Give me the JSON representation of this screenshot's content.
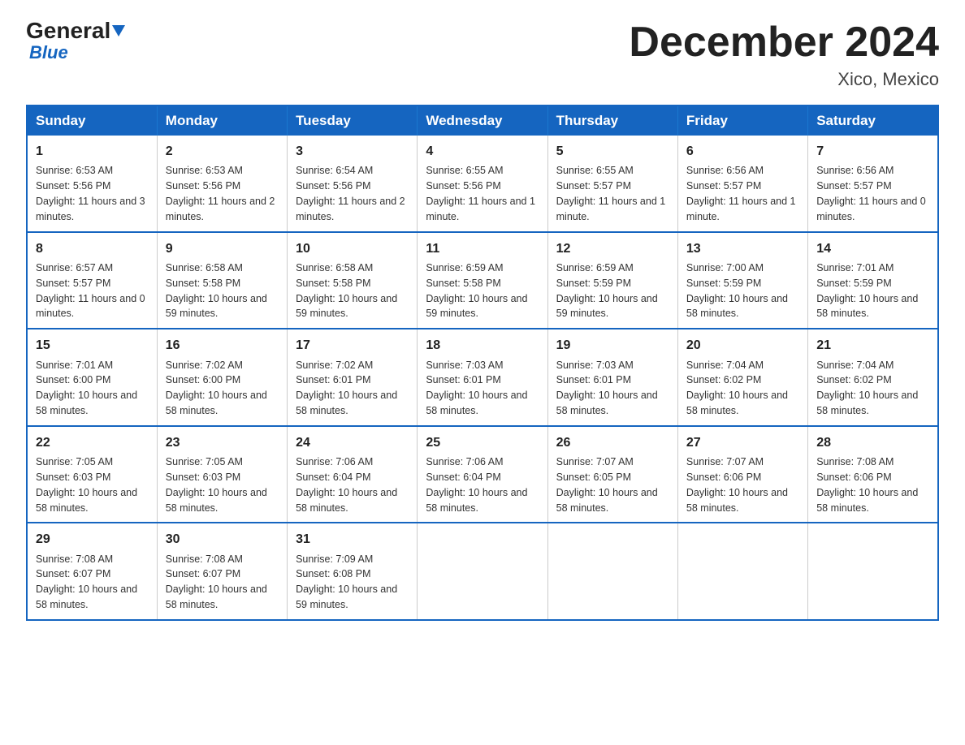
{
  "header": {
    "logo_general": "General",
    "logo_blue": "Blue",
    "title": "December 2024",
    "location": "Xico, Mexico"
  },
  "days_of_week": [
    "Sunday",
    "Monday",
    "Tuesday",
    "Wednesday",
    "Thursday",
    "Friday",
    "Saturday"
  ],
  "weeks": [
    [
      {
        "day": "1",
        "sunrise": "6:53 AM",
        "sunset": "5:56 PM",
        "daylight": "11 hours and 3 minutes."
      },
      {
        "day": "2",
        "sunrise": "6:53 AM",
        "sunset": "5:56 PM",
        "daylight": "11 hours and 2 minutes."
      },
      {
        "day": "3",
        "sunrise": "6:54 AM",
        "sunset": "5:56 PM",
        "daylight": "11 hours and 2 minutes."
      },
      {
        "day": "4",
        "sunrise": "6:55 AM",
        "sunset": "5:56 PM",
        "daylight": "11 hours and 1 minute."
      },
      {
        "day": "5",
        "sunrise": "6:55 AM",
        "sunset": "5:57 PM",
        "daylight": "11 hours and 1 minute."
      },
      {
        "day": "6",
        "sunrise": "6:56 AM",
        "sunset": "5:57 PM",
        "daylight": "11 hours and 1 minute."
      },
      {
        "day": "7",
        "sunrise": "6:56 AM",
        "sunset": "5:57 PM",
        "daylight": "11 hours and 0 minutes."
      }
    ],
    [
      {
        "day": "8",
        "sunrise": "6:57 AM",
        "sunset": "5:57 PM",
        "daylight": "11 hours and 0 minutes."
      },
      {
        "day": "9",
        "sunrise": "6:58 AM",
        "sunset": "5:58 PM",
        "daylight": "10 hours and 59 minutes."
      },
      {
        "day": "10",
        "sunrise": "6:58 AM",
        "sunset": "5:58 PM",
        "daylight": "10 hours and 59 minutes."
      },
      {
        "day": "11",
        "sunrise": "6:59 AM",
        "sunset": "5:58 PM",
        "daylight": "10 hours and 59 minutes."
      },
      {
        "day": "12",
        "sunrise": "6:59 AM",
        "sunset": "5:59 PM",
        "daylight": "10 hours and 59 minutes."
      },
      {
        "day": "13",
        "sunrise": "7:00 AM",
        "sunset": "5:59 PM",
        "daylight": "10 hours and 58 minutes."
      },
      {
        "day": "14",
        "sunrise": "7:01 AM",
        "sunset": "5:59 PM",
        "daylight": "10 hours and 58 minutes."
      }
    ],
    [
      {
        "day": "15",
        "sunrise": "7:01 AM",
        "sunset": "6:00 PM",
        "daylight": "10 hours and 58 minutes."
      },
      {
        "day": "16",
        "sunrise": "7:02 AM",
        "sunset": "6:00 PM",
        "daylight": "10 hours and 58 minutes."
      },
      {
        "day": "17",
        "sunrise": "7:02 AM",
        "sunset": "6:01 PM",
        "daylight": "10 hours and 58 minutes."
      },
      {
        "day": "18",
        "sunrise": "7:03 AM",
        "sunset": "6:01 PM",
        "daylight": "10 hours and 58 minutes."
      },
      {
        "day": "19",
        "sunrise": "7:03 AM",
        "sunset": "6:01 PM",
        "daylight": "10 hours and 58 minutes."
      },
      {
        "day": "20",
        "sunrise": "7:04 AM",
        "sunset": "6:02 PM",
        "daylight": "10 hours and 58 minutes."
      },
      {
        "day": "21",
        "sunrise": "7:04 AM",
        "sunset": "6:02 PM",
        "daylight": "10 hours and 58 minutes."
      }
    ],
    [
      {
        "day": "22",
        "sunrise": "7:05 AM",
        "sunset": "6:03 PM",
        "daylight": "10 hours and 58 minutes."
      },
      {
        "day": "23",
        "sunrise": "7:05 AM",
        "sunset": "6:03 PM",
        "daylight": "10 hours and 58 minutes."
      },
      {
        "day": "24",
        "sunrise": "7:06 AM",
        "sunset": "6:04 PM",
        "daylight": "10 hours and 58 minutes."
      },
      {
        "day": "25",
        "sunrise": "7:06 AM",
        "sunset": "6:04 PM",
        "daylight": "10 hours and 58 minutes."
      },
      {
        "day": "26",
        "sunrise": "7:07 AM",
        "sunset": "6:05 PM",
        "daylight": "10 hours and 58 minutes."
      },
      {
        "day": "27",
        "sunrise": "7:07 AM",
        "sunset": "6:06 PM",
        "daylight": "10 hours and 58 minutes."
      },
      {
        "day": "28",
        "sunrise": "7:08 AM",
        "sunset": "6:06 PM",
        "daylight": "10 hours and 58 minutes."
      }
    ],
    [
      {
        "day": "29",
        "sunrise": "7:08 AM",
        "sunset": "6:07 PM",
        "daylight": "10 hours and 58 minutes."
      },
      {
        "day": "30",
        "sunrise": "7:08 AM",
        "sunset": "6:07 PM",
        "daylight": "10 hours and 58 minutes."
      },
      {
        "day": "31",
        "sunrise": "7:09 AM",
        "sunset": "6:08 PM",
        "daylight": "10 hours and 59 minutes."
      },
      null,
      null,
      null,
      null
    ]
  ]
}
